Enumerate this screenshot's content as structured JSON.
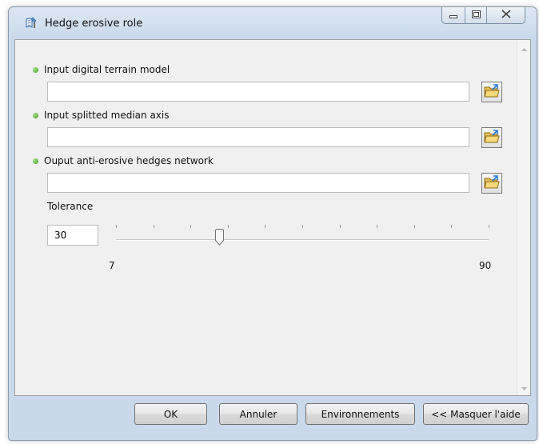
{
  "window": {
    "title": "Hedge erosive role",
    "icon": "toolbox-script-icon"
  },
  "params": [
    {
      "label": "Input digital terrain model",
      "value": "",
      "status_color": "#3f9a22"
    },
    {
      "label": "Input splitted median axis",
      "value": "",
      "status_color": "#3f9a22"
    },
    {
      "label": "Ouput anti-erosive hedges network",
      "value": "",
      "status_color": "#3f9a22"
    }
  ],
  "tolerance": {
    "label": "Tolerance",
    "value": "30",
    "min_label": "7",
    "max_label": "90",
    "min": 7,
    "max": 90,
    "current": 30
  },
  "buttons": {
    "ok": "OK",
    "cancel": "Annuler",
    "environments": "Environnements",
    "hide_help": "<< Masquer l'aide"
  },
  "icons": {
    "browse": "open-folder-icon",
    "minimize": "minimize-icon",
    "maximize": "maximize-icon",
    "close": "close-icon"
  }
}
